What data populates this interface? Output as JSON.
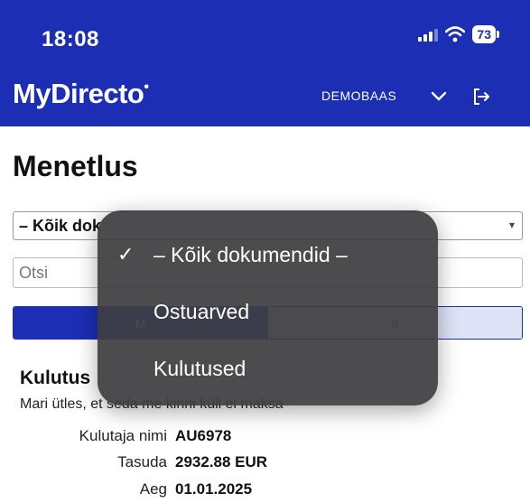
{
  "status_bar": {
    "time": "18:08",
    "battery": "73"
  },
  "header": {
    "logo": "MyDirecto",
    "database": "DEMOBAAS"
  },
  "page": {
    "title": "Menetlus"
  },
  "filter": {
    "selected": "– Kõik dokumendid –"
  },
  "search": {
    "placeholder": "Otsi"
  },
  "tabs": [
    {
      "label": "M"
    },
    {
      "label": "d"
    }
  ],
  "card": {
    "title": "Kulutus",
    "description": "Mari ütles, et seda me kinni küll ei maksa",
    "fields": [
      {
        "label": "Kulutaja nimi",
        "value": "AU6978"
      },
      {
        "label": "Tasuda",
        "value": "2932.88 EUR"
      },
      {
        "label": "Aeg",
        "value": "01.01.2025"
      }
    ]
  },
  "dropdown_menu": {
    "items": [
      {
        "label": "– Kõik dokumendid –",
        "checked": true
      },
      {
        "label": "Ostuarved",
        "checked": false
      },
      {
        "label": "Kulutused",
        "checked": false
      }
    ]
  },
  "colors": {
    "brand": "#1c2fb4",
    "popup": "#3e3e42",
    "tab_inactive": "#dfe3f8"
  }
}
